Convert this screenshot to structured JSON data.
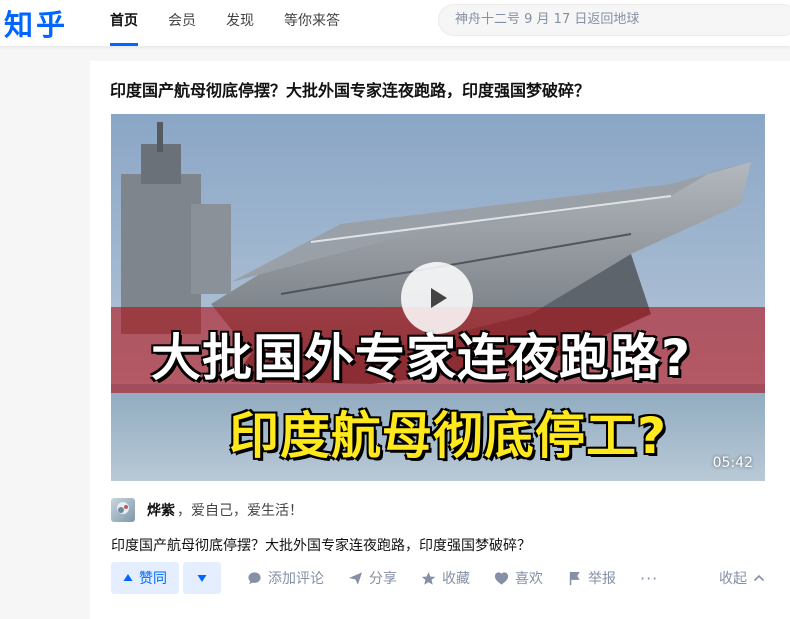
{
  "app": {
    "logo": "知乎"
  },
  "nav": {
    "items": [
      {
        "label": "首页",
        "active": true
      },
      {
        "label": "会员",
        "active": false
      },
      {
        "label": "发现",
        "active": false
      },
      {
        "label": "等你来答",
        "active": false
      }
    ]
  },
  "search": {
    "placeholder": "神舟十二号 9 月 17 日返回地球"
  },
  "card": {
    "title": "印度国产航母彻底停摆？大批外国专家连夜跑路，印度强国梦破碎？",
    "video": {
      "caption_line1": "大批国外专家连夜跑路?",
      "caption_line2": "印度航母彻底停工?",
      "duration": "05:42"
    },
    "author": {
      "name": "烨紫",
      "bio": "，爱自己，爱生活！"
    },
    "excerpt": "印度国产航母彻底停摆？大批外国专家连夜跑路，印度强国梦破碎？",
    "actions": {
      "vote_up": "赞同",
      "comment": "添加评论",
      "share": "分享",
      "favorite": "收藏",
      "like": "喜欢",
      "report": "举报",
      "more": "···",
      "collapse": "收起"
    }
  },
  "colors": {
    "brand": "#0066ff",
    "vote_bg": "#e5eeff",
    "meta": "#8590a6"
  }
}
